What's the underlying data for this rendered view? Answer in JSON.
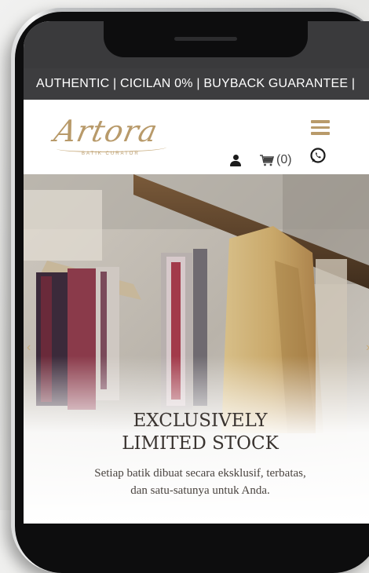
{
  "ticker": {
    "text": "AUTHENTIC | CICILAN 0% | BUYBACK GUARANTEE |"
  },
  "brand": {
    "logo_text": "Artora",
    "tagline": "BATIK CURATOR",
    "accent_color": "#b89a6a"
  },
  "header": {
    "menu_icon": "hamburger-icon",
    "account_icon": "user-icon",
    "cart_icon": "cart-icon",
    "cart_count": "(0)",
    "chat_icon": "whatsapp-icon"
  },
  "hero": {
    "title_line1": "EXCLUSIVELY",
    "title_line2": "LIMITED STOCK",
    "subtitle_line1": "Setiap batik dibuat secara eksklusif, terbatas,",
    "subtitle_line2": "dan satu-satunya untuk Anda.",
    "prev_label": "‹",
    "next_label": "›"
  }
}
